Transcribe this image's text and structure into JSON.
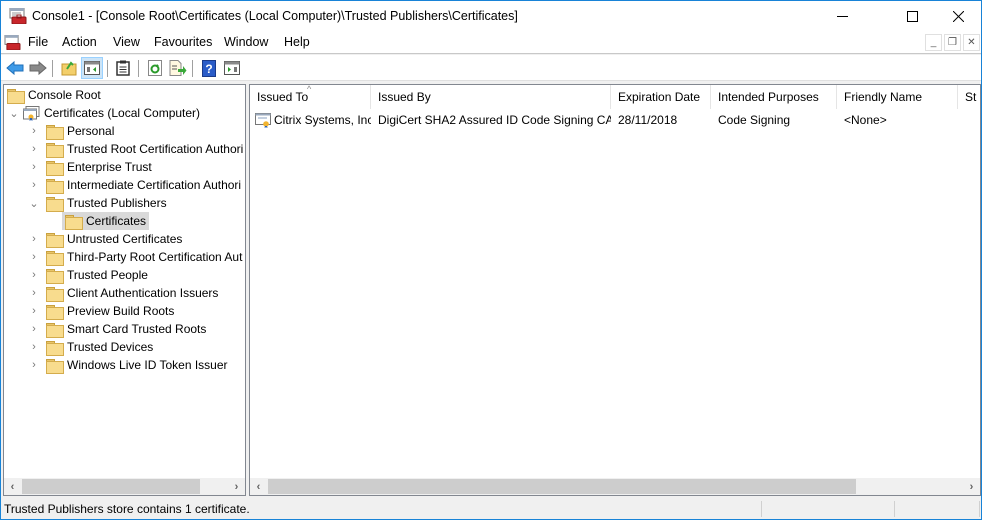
{
  "window": {
    "title": "Console1 - [Console Root\\Certificates (Local Computer)\\Trusted Publishers\\Certificates]",
    "app_icon": "mmc-console-icon",
    "controls": {
      "minimize": "minimize-icon",
      "maximize": "maximize-icon",
      "close": "close-icon"
    }
  },
  "menubar": {
    "items": [
      {
        "label": "File"
      },
      {
        "label": "Action"
      },
      {
        "label": "View"
      },
      {
        "label": "Favourites"
      },
      {
        "label": "Window"
      },
      {
        "label": "Help"
      }
    ],
    "mdi_controls": {
      "minimize": "_",
      "restore": "❐",
      "close": "✕"
    }
  },
  "toolbar": {
    "buttons": [
      {
        "name": "back",
        "icon": "back-arrow-icon"
      },
      {
        "name": "forward",
        "icon": "forward-arrow-icon"
      },
      {
        "name": "up-one-level",
        "icon": "folder-up-icon"
      },
      {
        "name": "show-hide-console-tree",
        "icon": "console-tree-icon",
        "active": true
      },
      {
        "name": "properties",
        "icon": "clipboard-icon"
      },
      {
        "name": "refresh",
        "icon": "refresh-icon"
      },
      {
        "name": "export-list",
        "icon": "export-list-icon"
      },
      {
        "name": "help",
        "icon": "help-icon"
      },
      {
        "name": "show-action-pane",
        "icon": "action-pane-icon"
      }
    ]
  },
  "tree": {
    "root": {
      "label": "Console Root"
    },
    "snapin": {
      "label": "Certificates (Local Computer)",
      "expanded": true
    },
    "stores": [
      {
        "label": "Personal",
        "expanded": false
      },
      {
        "label": "Trusted Root Certification Authori",
        "expanded": false
      },
      {
        "label": "Enterprise Trust",
        "expanded": false
      },
      {
        "label": "Intermediate Certification Authori",
        "expanded": false
      },
      {
        "label": "Trusted Publishers",
        "expanded": true,
        "children": [
          {
            "label": "Certificates",
            "selected": true
          }
        ]
      },
      {
        "label": "Untrusted Certificates",
        "expanded": false
      },
      {
        "label": "Third-Party Root Certification Aut",
        "expanded": false
      },
      {
        "label": "Trusted People",
        "expanded": false
      },
      {
        "label": "Client Authentication Issuers",
        "expanded": false
      },
      {
        "label": "Preview Build Roots",
        "expanded": false
      },
      {
        "label": "Smart Card Trusted Roots",
        "expanded": false
      },
      {
        "label": "Trusted Devices",
        "expanded": false
      },
      {
        "label": "Windows Live ID Token Issuer",
        "expanded": false
      }
    ]
  },
  "list": {
    "columns": [
      "Issued To",
      "Issued By",
      "Expiration Date",
      "Intended Purposes",
      "Friendly Name",
      "St"
    ],
    "sorted_column": "Issued To",
    "rows": [
      {
        "issued_to": "Citrix Systems, Inc.",
        "issued_by": "DigiCert SHA2 Assured ID Code Signing CA",
        "expiration_date": "28/11/2018",
        "intended_purposes": "Code Signing",
        "friendly_name": "<None>"
      }
    ]
  },
  "statusbar": {
    "text": "Trusted Publishers store contains 1 certificate."
  }
}
